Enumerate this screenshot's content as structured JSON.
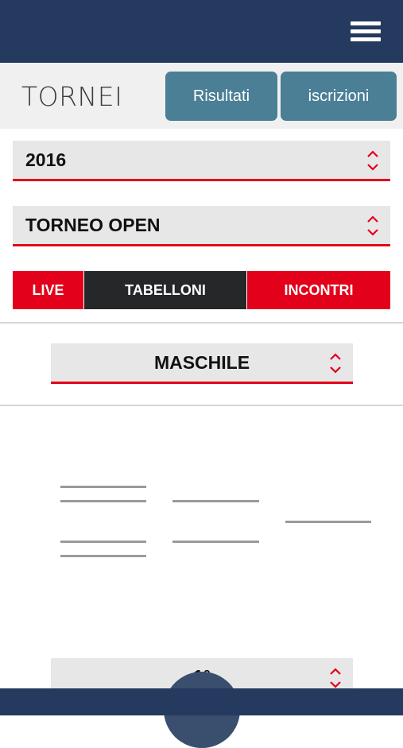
{
  "header": {
    "menu_icon": "hamburger-icon"
  },
  "subheader": {
    "title": "TORNEI",
    "buttons": {
      "risultati": "Risultati",
      "iscrizioni": "iscrizioni"
    }
  },
  "filters": {
    "year": {
      "value": "2016",
      "icon": "chevron-up-down-icon"
    },
    "tournament": {
      "value": "TORNEO OPEN",
      "icon": "chevron-up-down-icon"
    }
  },
  "tabs": [
    {
      "label": "LIVE",
      "active": false
    },
    {
      "label": "TABELLONI",
      "active": true
    },
    {
      "label": "INCONTRI",
      "active": false
    }
  ],
  "bracket": {
    "gender": "MASCHILE",
    "round": "1°"
  },
  "colors": {
    "navy": "#243a5e",
    "accent_red": "#e3001b",
    "button_teal": "#4a7f96",
    "tab_dark": "#262728"
  }
}
